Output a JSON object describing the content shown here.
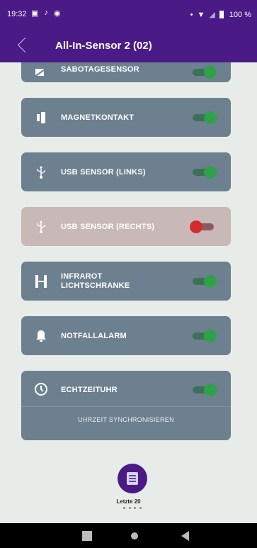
{
  "status_bar": {
    "time": "19:32",
    "battery": "100 %"
  },
  "app_bar": {
    "title": "All-In-Sensor 2 (02)"
  },
  "sensors": [
    {
      "label": "SABOTAGESENSOR",
      "state": "on",
      "icon": "sabotage-icon"
    },
    {
      "label": "MAGNETKONTAKT",
      "state": "on",
      "icon": "magnet-contact-icon"
    },
    {
      "label": "USB SENSOR (LINKS)",
      "state": "on",
      "icon": "usb-icon"
    },
    {
      "label": "USB SENSOR (RECHTS)",
      "state": "off",
      "icon": "usb-icon"
    },
    {
      "label": "INFRAROT\nLICHTSCHRANKE",
      "label_line1": "INFRAROT",
      "label_line2": "LICHTSCHRANKE",
      "state": "on",
      "icon": "infrared-icon"
    },
    {
      "label": "NOTFALLALARM",
      "state": "on",
      "icon": "bell-icon"
    },
    {
      "label": "ECHTZEITUHR",
      "state": "on",
      "icon": "clock-icon",
      "action": "UHRZEIT SYNCHRONISIEREN"
    }
  ],
  "history_button": {
    "label": "Letzte 20"
  },
  "colors": {
    "primary": "#4a1a86",
    "card": "#6d808f",
    "card_disabled": "#c9b8b8",
    "toggle_on": "#2fa14a",
    "toggle_off": "#d22c2c"
  }
}
